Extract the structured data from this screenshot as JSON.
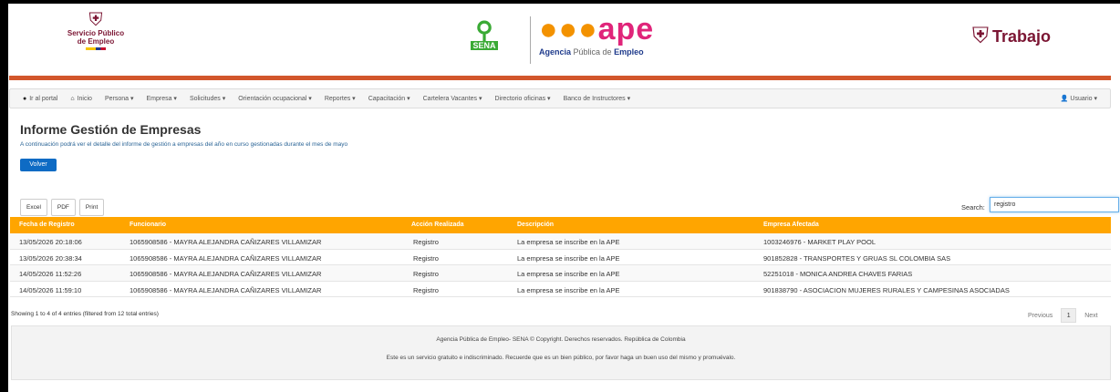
{
  "header": {
    "left_logo": {
      "line1": "Servicio Público",
      "line2": "de Empleo"
    },
    "sena_text": "SENA",
    "ape_text": "ape",
    "ape_sub": {
      "a": "Agencia",
      "b": "Pública de",
      "c": "Empleo"
    },
    "right_logo": "Trabajo"
  },
  "nav": {
    "items": [
      {
        "label": "Ir al portal",
        "icon": "circle-arrow-icon"
      },
      {
        "label": "Inicio",
        "icon": "home-icon"
      },
      {
        "label": "Persona ▾"
      },
      {
        "label": "Empresa ▾"
      },
      {
        "label": "Solicitudes ▾"
      },
      {
        "label": "Orientación ocupacional ▾"
      },
      {
        "label": "Reportes ▾"
      },
      {
        "label": "Capacitación ▾"
      },
      {
        "label": "Cartelera Vacantes ▾"
      },
      {
        "label": "Directorio oficinas ▾"
      },
      {
        "label": "Banco de Instructores ▾"
      }
    ],
    "user": "Usuario ▾"
  },
  "main": {
    "title": "Informe Gestión de Empresas",
    "subtitle": "A continuación podrá ver el detalle del informe de gestión a empresas del año en curso gestionadas durante el mes de mayo",
    "back_label": "Volver"
  },
  "tools": {
    "excel": "Excel",
    "pdf": "PDF",
    "print": "Print"
  },
  "search": {
    "label": "Search:",
    "value": "registro"
  },
  "table": {
    "headers": [
      "Fecha de Registro",
      "Funcionario",
      "Acción Realizada",
      "Descripción",
      "Empresa Afectada"
    ],
    "rows": [
      [
        "13/05/2026 20:18:06",
        "1065908586 - MAYRA ALEJANDRA CAÑIZARES VILLAMIZAR",
        "Registro",
        "La empresa se inscribe en la APE",
        "1003246976 - MARKET PLAY POOL"
      ],
      [
        "13/05/2026 20:38:34",
        "1065908586 - MAYRA ALEJANDRA CAÑIZARES VILLAMIZAR",
        "Registro",
        "La empresa se inscribe en la APE",
        "901852828 - TRANSPORTES Y GRUAS SL COLOMBIA SAS"
      ],
      [
        "14/05/2026 11:52:26",
        "1065908586 - MAYRA ALEJANDRA CAÑIZARES VILLAMIZAR",
        "Registro",
        "La empresa se inscribe en la APE",
        "52251018 - MONICA ANDREA CHAVES FARIAS"
      ],
      [
        "14/05/2026 11:59:10",
        "1065908586 - MAYRA ALEJANDRA CAÑIZARES VILLAMIZAR",
        "Registro",
        "La empresa se inscribe en la APE",
        "901838790 - ASOCIACION MUJERES RURALES Y CAMPESINAS ASOCIADAS"
      ]
    ]
  },
  "info": "Showing 1 to 4 of 4 entries (filtered from 12 total entries)",
  "pager": {
    "previous": "Previous",
    "page": "1",
    "next": "Next"
  },
  "footer": {
    "line1": "Agencia Pública de Empleo- SENA © Copyright. Derechos reservados. República de Colombia",
    "line2": "Este es un servicio gratuito e indiscriminado. Recuerde que es un bien público, por favor haga un buen uso del mismo y promuévalo."
  },
  "colors": {
    "orange": "#ffa500",
    "brand_bar": "#d2562b",
    "button_blue": "#0e6bc4"
  }
}
